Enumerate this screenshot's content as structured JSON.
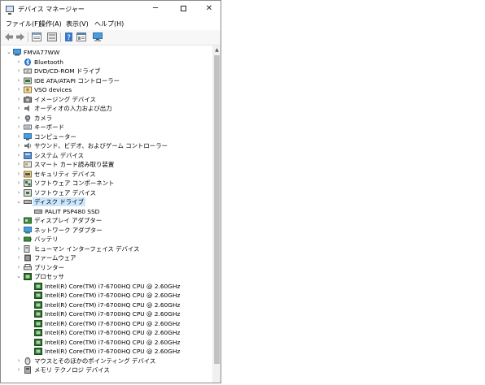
{
  "window": {
    "title": "デバイス マネージャー"
  },
  "menu": [
    "ファイル(F)",
    "操作(A)",
    "表示(V)",
    "ヘルプ(H)"
  ],
  "toolbar": [
    "back",
    "forward",
    "properties-view",
    "show-hidden",
    "help",
    "device-list",
    "computer-monitor"
  ],
  "tree": [
    {
      "level": 0,
      "expander": "expanded",
      "icon": "computer-icon",
      "label": "FMVA77WW"
    },
    {
      "level": 1,
      "expander": "collapsed",
      "icon": "bluetooth-icon",
      "label": "Bluetooth"
    },
    {
      "level": 1,
      "expander": "collapsed",
      "icon": "dvd-drive-icon",
      "label": "DVD/CD-ROM ドライブ"
    },
    {
      "level": 1,
      "expander": "collapsed",
      "icon": "ide-controller-icon",
      "label": "IDE ATA/ATAPI コントローラー"
    },
    {
      "level": 1,
      "expander": "collapsed",
      "icon": "vso-device-icon",
      "label": "VSO devices"
    },
    {
      "level": 1,
      "expander": "collapsed",
      "icon": "imaging-device-icon",
      "label": "イメージング デバイス"
    },
    {
      "level": 1,
      "expander": "collapsed",
      "icon": "audio-io-icon",
      "label": "オーディオの入力および出力"
    },
    {
      "level": 1,
      "expander": "collapsed",
      "icon": "camera-icon",
      "label": "カメラ"
    },
    {
      "level": 1,
      "expander": "collapsed",
      "icon": "keyboard-icon",
      "label": "キーボード"
    },
    {
      "level": 1,
      "expander": "collapsed",
      "icon": "monitor-icon",
      "label": "コンピューター"
    },
    {
      "level": 1,
      "expander": "collapsed",
      "icon": "sound-controller-icon",
      "label": "サウンド、ビデオ、およびゲーム コントローラー"
    },
    {
      "level": 1,
      "expander": "collapsed",
      "icon": "system-device-icon",
      "label": "システム デバイス"
    },
    {
      "level": 1,
      "expander": "collapsed",
      "icon": "smart-card-reader-icon",
      "label": "スマート カード読み取り装置"
    },
    {
      "level": 1,
      "expander": "collapsed",
      "icon": "security-device-icon",
      "label": "セキュリティ デバイス"
    },
    {
      "level": 1,
      "expander": "collapsed",
      "icon": "software-component-icon",
      "label": "ソフトウェア コンポーネント"
    },
    {
      "level": 1,
      "expander": "collapsed",
      "icon": "software-device-icon",
      "label": "ソフトウェア デバイス"
    },
    {
      "level": 1,
      "expander": "expanded",
      "icon": "disk-drive-icon",
      "label": "ディスク ドライブ",
      "selected": true
    },
    {
      "level": 2,
      "expander": "none",
      "icon": "disk-drive-icon",
      "label": "PALIT PSP480 SSD"
    },
    {
      "level": 1,
      "expander": "collapsed",
      "icon": "display-adapter-icon",
      "label": "ディスプレイ アダプター"
    },
    {
      "level": 1,
      "expander": "collapsed",
      "icon": "network-adapter-icon",
      "label": "ネットワーク アダプター"
    },
    {
      "level": 1,
      "expander": "collapsed",
      "icon": "battery-icon",
      "label": "バッテリ"
    },
    {
      "level": 1,
      "expander": "collapsed",
      "icon": "hid-icon",
      "label": "ヒューマン インターフェイス デバイス"
    },
    {
      "level": 1,
      "expander": "collapsed",
      "icon": "firmware-icon",
      "label": "ファームウェア"
    },
    {
      "level": 1,
      "expander": "collapsed",
      "icon": "printer-icon",
      "label": "プリンター"
    },
    {
      "level": 1,
      "expander": "expanded",
      "icon": "processor-icon",
      "label": "プロセッサ"
    },
    {
      "level": 2,
      "expander": "none",
      "icon": "processor-icon",
      "label": "Intel(R) Core(TM) i7-6700HQ CPU @ 2.60GHz"
    },
    {
      "level": 2,
      "expander": "none",
      "icon": "processor-icon",
      "label": "Intel(R) Core(TM) i7-6700HQ CPU @ 2.60GHz"
    },
    {
      "level": 2,
      "expander": "none",
      "icon": "processor-icon",
      "label": "Intel(R) Core(TM) i7-6700HQ CPU @ 2.60GHz"
    },
    {
      "level": 2,
      "expander": "none",
      "icon": "processor-icon",
      "label": "Intel(R) Core(TM) i7-6700HQ CPU @ 2.60GHz"
    },
    {
      "level": 2,
      "expander": "none",
      "icon": "processor-icon",
      "label": "Intel(R) Core(TM) i7-6700HQ CPU @ 2.60GHz"
    },
    {
      "level": 2,
      "expander": "none",
      "icon": "processor-icon",
      "label": "Intel(R) Core(TM) i7-6700HQ CPU @ 2.60GHz"
    },
    {
      "level": 2,
      "expander": "none",
      "icon": "processor-icon",
      "label": "Intel(R) Core(TM) i7-6700HQ CPU @ 2.60GHz"
    },
    {
      "level": 2,
      "expander": "none",
      "icon": "processor-icon",
      "label": "Intel(R) Core(TM) i7-6700HQ CPU @ 2.60GHz"
    },
    {
      "level": 1,
      "expander": "collapsed",
      "icon": "mouse-icon",
      "label": "マウスとそのほかのポインティング デバイス"
    },
    {
      "level": 1,
      "expander": "collapsed",
      "icon": "usb-device-icon",
      "label": "メモリ テクノロジ デバイス"
    }
  ],
  "colors": {
    "selection": "#cce8ff",
    "window_border": "#8a8a8a",
    "scroll_thumb": "#c2c2c2"
  }
}
